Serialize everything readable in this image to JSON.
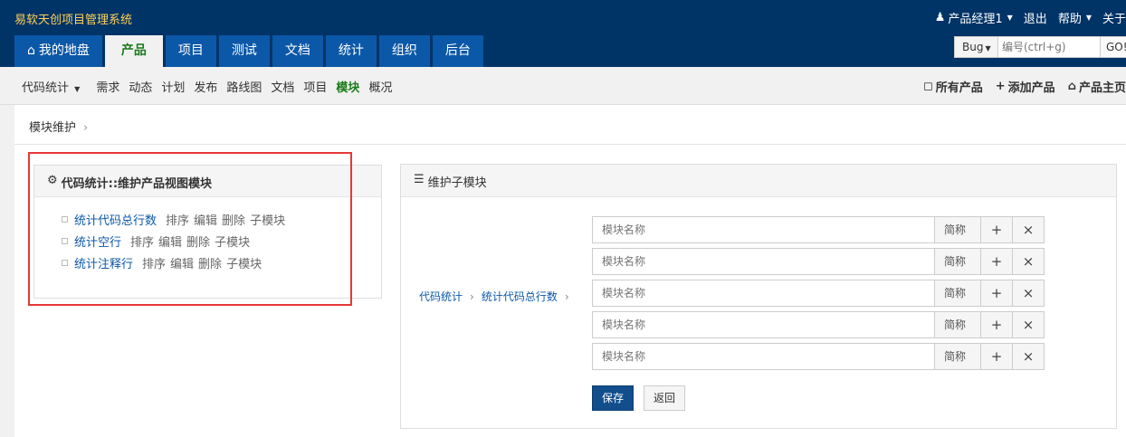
{
  "app_title": "易软天创项目管理系统",
  "user_menu": {
    "user": "产品经理1",
    "logout": "退出",
    "help": "帮助",
    "about": "关于"
  },
  "main_nav": [
    "我的地盘",
    "产品",
    "项目",
    "测试",
    "文档",
    "统计",
    "组织",
    "后台"
  ],
  "search": {
    "type": "Bug",
    "placeholder": "编号(ctrl+g)",
    "go": "GO!"
  },
  "sub_nav": {
    "product": "代码统计",
    "items": [
      "需求",
      "动态",
      "计划",
      "发布",
      "路线图",
      "文档",
      "项目",
      "模块",
      "概况"
    ],
    "right": [
      "所有产品",
      "添加产品",
      "产品主页"
    ]
  },
  "breadcrumb": "模块维护",
  "left_panel": {
    "title": "代码统计::维护产品视图模块",
    "modules": [
      "统计代码总行数",
      "统计空行",
      "统计注释行"
    ],
    "actions": [
      "排序",
      "编辑",
      "删除",
      "子模块"
    ]
  },
  "right_panel": {
    "title": "维护子模块",
    "path": [
      "代码统计",
      "统计代码总行数"
    ],
    "rows": [
      {
        "placeholder": "模块名称",
        "short": "简称"
      },
      {
        "placeholder": "模块名称",
        "short": "简称"
      },
      {
        "placeholder": "模块名称",
        "short": "简称"
      },
      {
        "placeholder": "模块名称",
        "short": "简称"
      },
      {
        "placeholder": "模块名称",
        "short": "简称"
      }
    ],
    "save": "保存",
    "back": "返回"
  },
  "colors": {
    "header": "#003366",
    "tab": "#0c58a8",
    "active": "#1a7a1a",
    "link": "#0c58a8",
    "highlight": "#e53935"
  }
}
